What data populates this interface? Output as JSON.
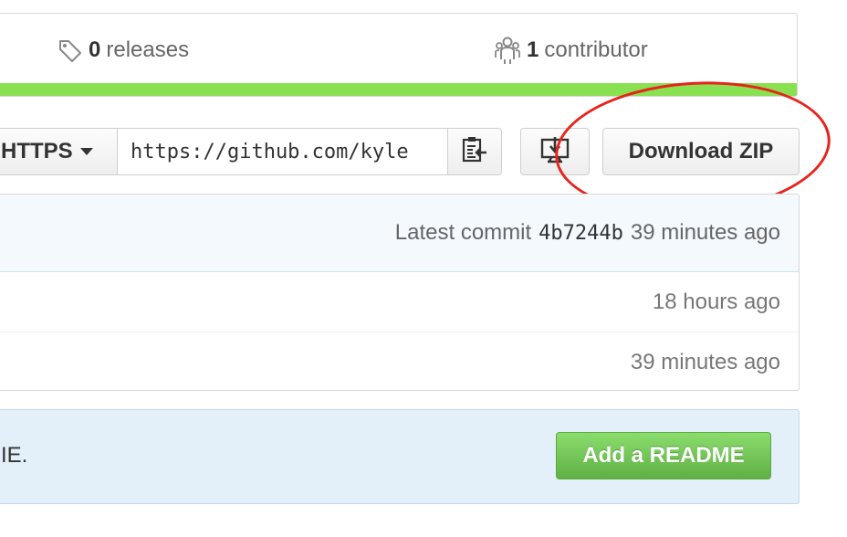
{
  "summary": {
    "releases_count": "0",
    "releases_label": "releases",
    "contributors_count": "1",
    "contributors_label": "contributor",
    "language_bar_color": "#89e051"
  },
  "clone": {
    "protocol_label": "HTTPS",
    "url_value": "https://github.com/kyle",
    "download_zip_label": "Download ZIP"
  },
  "commit_tease": {
    "prefix": "Latest commit",
    "sha": "4b7244b",
    "age": "39 minutes ago"
  },
  "files": [
    {
      "age": "18 hours ago"
    },
    {
      "age": "39 minutes ago"
    }
  ],
  "readme": {
    "text_fragment": "IE.",
    "button_label": "Add a README"
  },
  "annotation": {
    "ellipse_color": "#e8231c"
  }
}
